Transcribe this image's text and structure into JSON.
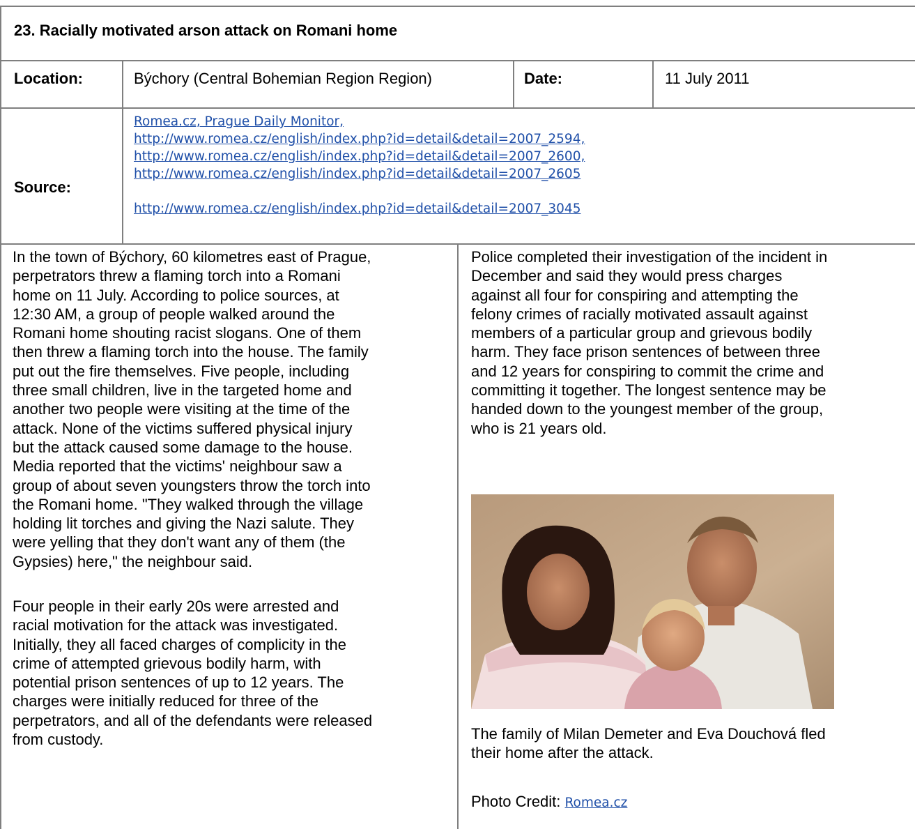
{
  "title": "23. Racially motivated arson attack on Romani home",
  "location": {
    "label": "Location:",
    "value": "Býchory (Central Bohemian Region Region)"
  },
  "date": {
    "label": "Date:",
    "value": "11 July 2011"
  },
  "source": {
    "label": "Source:",
    "links": [
      "Romea.cz, Prague Daily Monitor,",
      "http://www.romea.cz/english/index.php?id=detail&detail=2007_2594,",
      "http://www.romea.cz/english/index.php?id=detail&detail=2007_2600,",
      "http://www.romea.cz/english/index.php?id=detail&detail=2007_2605",
      "http://www.romea.cz/english/index.php?id=detail&detail=2007_3045"
    ]
  },
  "left_column": {
    "paragraph_1": "In the town of Býchory, 60 kilometres east of Prague,\nperpetrators threw a flaming torch into a Romani\nhome on 11 July. According to police sources, at\n12:30 AM, a group of people walked around the\nRomani home shouting racist slogans. One of them\nthen threw a flaming torch into the house. The family\nput out the fire themselves. Five people, including\nthree small children, live in the targeted home and\nanother two people were visiting at the time of the\nattack. None of the victims suffered physical injury\nbut the attack caused some damage to the house.\nMedia reported that the victims' neighbour saw a\ngroup of about seven youngsters throw the torch into\nthe Romani home. \"They walked through the village\nholding lit torches and giving the Nazi salute. They\nwere yelling that they don't want any of them (the\nGypsies) here,\" the neighbour said.",
    "paragraph_2": "Four people in their early 20s were arrested and\nracial motivation for the attack was investigated.\nInitially, they all faced charges of complicity in the\ncrime of attempted grievous bodily harm, with\npotential prison sentences of up to 12 years. The\ncharges were initially reduced for three of the\nperpetrators, and all of the defendants were released\nfrom custody."
  },
  "right_column": {
    "paragraph_1": "Police completed their investigation of the incident in\nDecember and said they would press charges\nagainst all four for conspiring and attempting the\nfelony crimes of racially motivated assault against\nmembers of a particular group and grievous bodily\nharm. They face prison sentences of between three\nand 12 years for conspiring to commit the crime and\ncommitting it together. The longest sentence may be\nhanded down to the youngest member of the group,\nwho is 21 years old.",
    "caption": "The family of Milan Demeter and Eva Douchová fled\ntheir home after the attack.",
    "credit_label": "Photo Credit: ",
    "credit_link": "Romea.cz"
  }
}
